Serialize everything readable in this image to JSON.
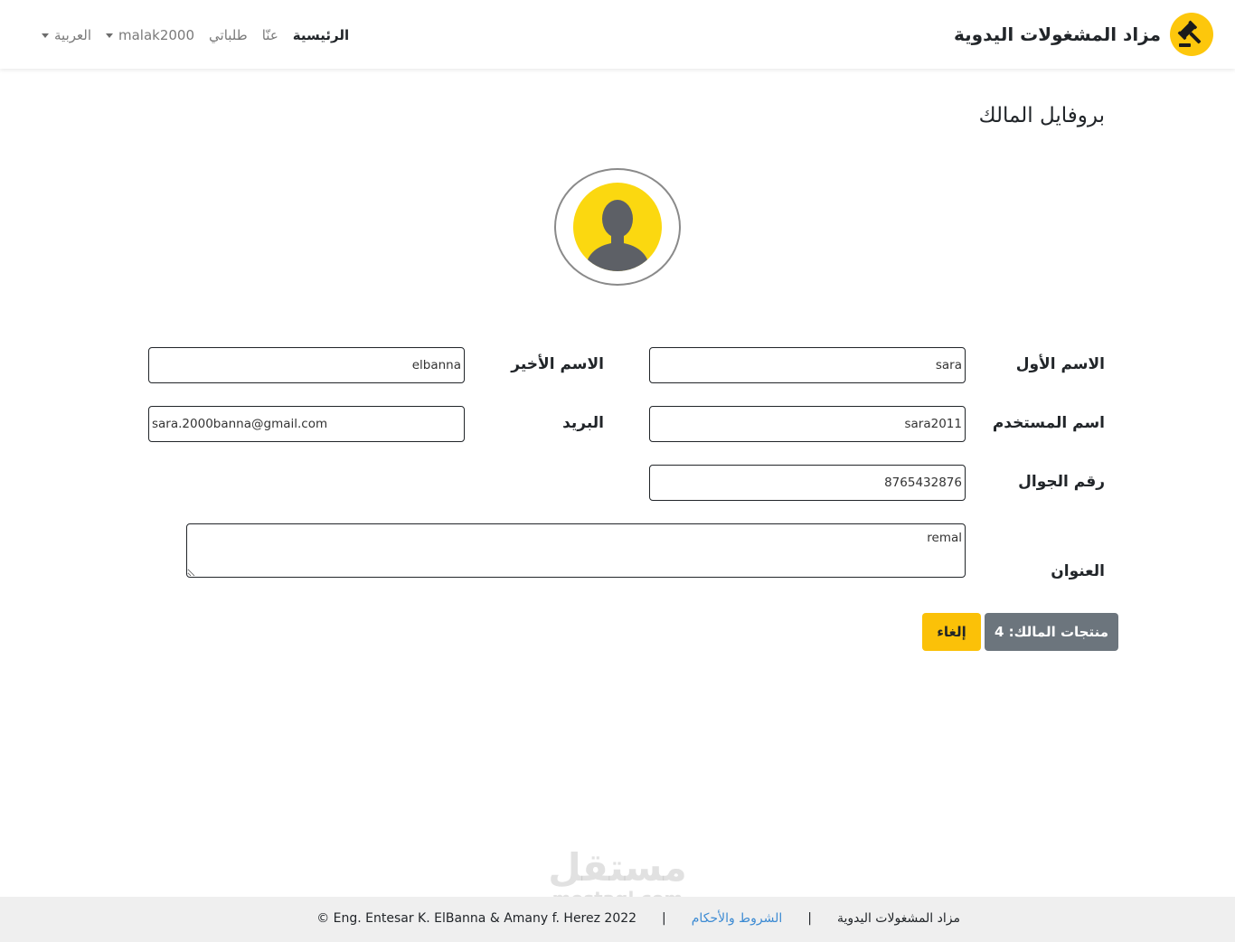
{
  "navbar": {
    "brand_title": "مزاد المشغولات اليدوية",
    "logo_icon": "gavel-icon",
    "items": [
      {
        "label": "الرئيسية",
        "active": true
      },
      {
        "label": "عنّا"
      },
      {
        "label": "طلباتي"
      },
      {
        "label": "malak2000",
        "dropdown": true
      },
      {
        "label": "العربية",
        "dropdown": true
      }
    ]
  },
  "profile": {
    "title": "بروفايل المالك",
    "avatar_icon": "user-avatar-icon",
    "fields": {
      "first_name": {
        "label": "الاسم الأول",
        "value": "sara"
      },
      "last_name": {
        "label": "الاسم الأخير",
        "value": "elbanna"
      },
      "username": {
        "label": "اسم المستخدم",
        "value": "sara2011"
      },
      "email": {
        "label": "البريد",
        "value": "sara.2000banna@gmail.com"
      },
      "phone": {
        "label": "رقم الجوال",
        "value": "8765432876"
      },
      "address": {
        "label": "العنوان",
        "value": "remal"
      }
    },
    "buttons": {
      "products": "منتجات المالك: 4",
      "cancel": "إلغاء"
    }
  },
  "footer": {
    "site_name": "مزاد المشغولات اليدوية",
    "terms_link": "الشروط والأحكام",
    "copyright": "© Eng. Entesar K. ElBanna & Amany f. Herez 2022",
    "separator": "|"
  },
  "watermark": {
    "arabic": "مستقل",
    "latin": "mostaql.com"
  },
  "colors": {
    "accent_yellow": "#fbc108",
    "secondary_gray": "#6c757d",
    "link_blue": "#3d8bd3",
    "footer_bg": "#efefef"
  }
}
